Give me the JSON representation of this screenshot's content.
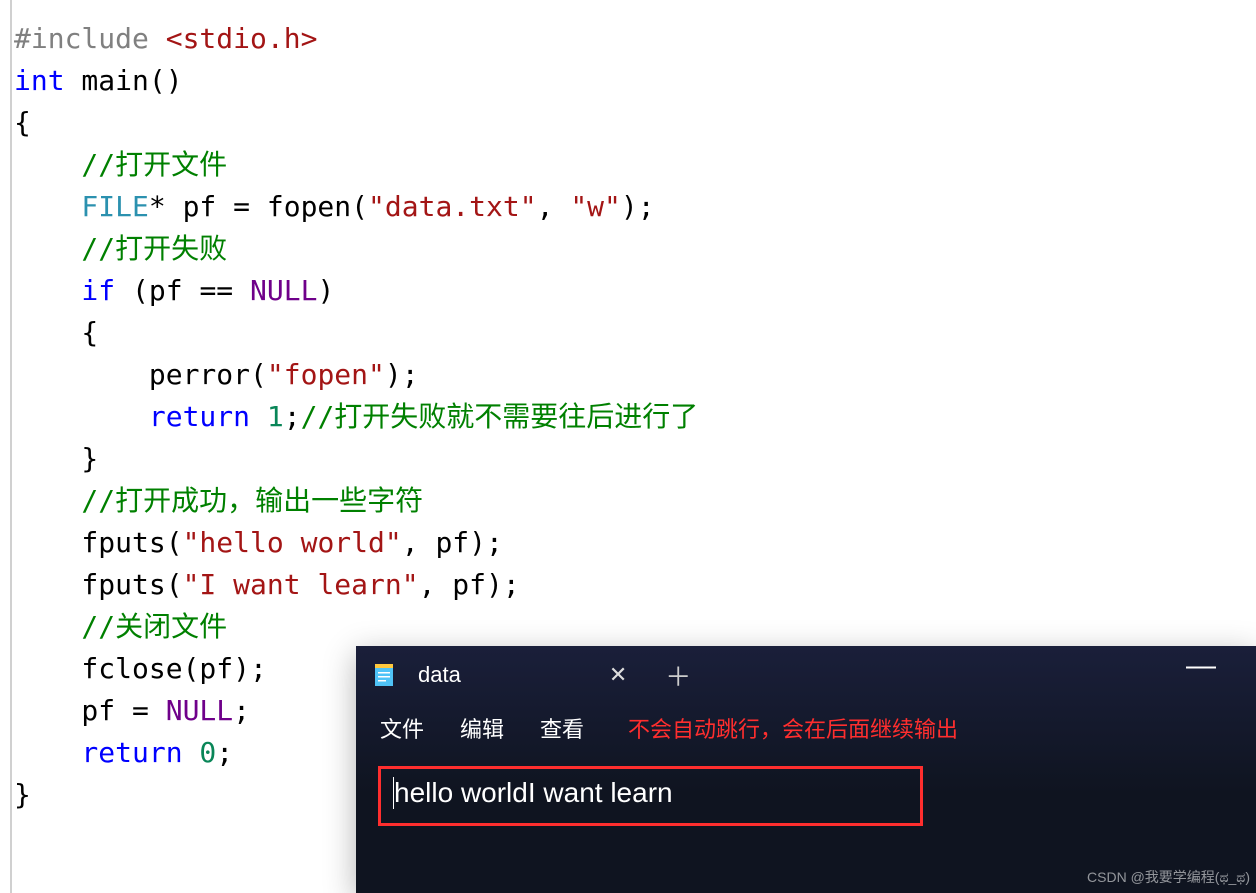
{
  "code": {
    "l1_pre": "#include",
    "l1_inc": " <stdio.h>",
    "l2_kw": "int",
    "l2_func": " main()",
    "l3": "{",
    "l4_com": "    //打开文件",
    "l5_type": "    FILE",
    "l5_rest1": "* pf = fopen(",
    "l5_str1": "\"data.txt\"",
    "l5_rest2": ", ",
    "l5_str2": "\"w\"",
    "l5_rest3": ");",
    "l6_com": "    //打开失败",
    "l7_kw": "    if",
    "l7_rest": " (pf == ",
    "l7_null": "NULL",
    "l7_close": ")",
    "l8": "    {",
    "l9_func": "        perror(",
    "l9_str": "\"fopen\"",
    "l9_close": ");",
    "l10_kw": "        return",
    "l10_num": " 1",
    "l10_semi": ";",
    "l10_com": "//打开失败就不需要往后进行了",
    "l11": "    }",
    "l12_com": "    //打开成功，输出一些字符",
    "l13_a": "    fputs(",
    "l13_str": "\"hello world\"",
    "l13_b": ", pf);",
    "l14_a": "    fputs(",
    "l14_str": "\"I want learn\"",
    "l14_b": ", pf);",
    "l15_com": "    //关闭文件",
    "l16": "    fclose(pf);",
    "l17_a": "    pf = ",
    "l17_null": "NULL",
    "l17_b": ";",
    "l18_kw": "    return",
    "l18_num": " 0",
    "l18_b": ";",
    "l19": "}"
  },
  "notepad": {
    "tab_title": "data",
    "menu_file": "文件",
    "menu_edit": "编辑",
    "menu_view": "查看",
    "annotation": "不会自动跳行，会在后面继续输出",
    "content": "hello worldI want learn"
  },
  "watermark": "CSDN @我要学编程(ಥ_ಥ)"
}
